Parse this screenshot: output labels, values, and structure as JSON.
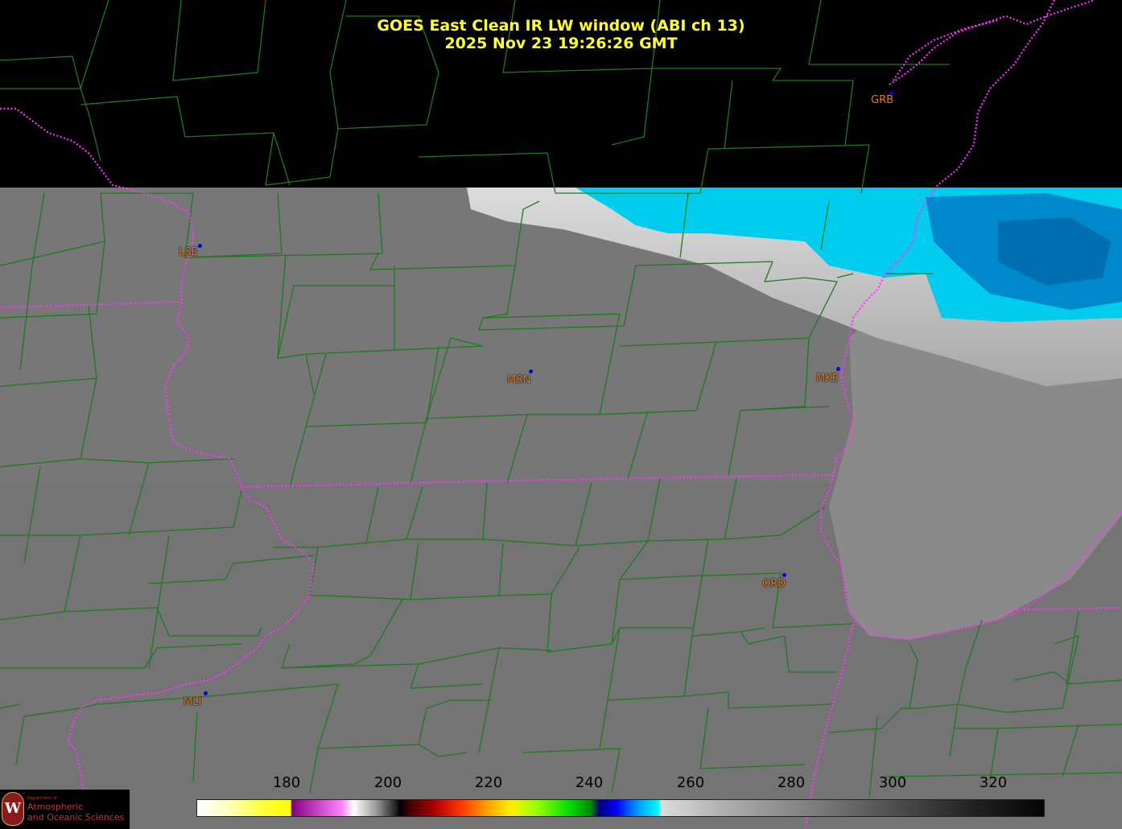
{
  "title_line1": "GOES East Clean IR LW window (ABI ch 13)",
  "title_line2": "2025 Nov 23  19:26:26 GMT",
  "cities": [
    {
      "code": "GRB",
      "id": "grb"
    },
    {
      "code": "LSE",
      "id": "lse"
    },
    {
      "code": "MSN",
      "id": "msn"
    },
    {
      "code": "MKE",
      "id": "mke"
    },
    {
      "code": "ORD",
      "id": "ord"
    },
    {
      "code": "MLI",
      "id": "mli"
    }
  ],
  "colorbar": {
    "unit_min": 165,
    "unit_max": 330,
    "ticks": [
      "180",
      "200",
      "220",
      "240",
      "260",
      "280",
      "300",
      "320"
    ]
  },
  "logo": {
    "line1": "Department of",
    "line2": "Atmospheric",
    "line3": "and Oceanic Sciences",
    "seal_letter": "W"
  },
  "colors": {
    "title": "#ffff33",
    "county_lines": "#1f7a1f",
    "state_lines": "#ff33ff",
    "city_label": "#e07a20",
    "city_dot": "#0000ee",
    "cloud_cyan": "#00ccee",
    "cloud_blue": "#0088cc",
    "ground_gray": "#777777",
    "no_data": "#000000"
  }
}
